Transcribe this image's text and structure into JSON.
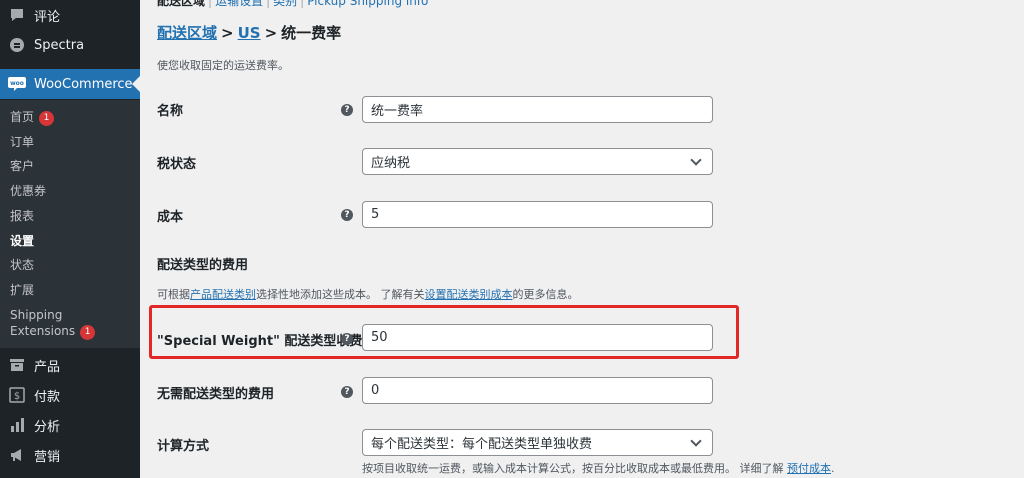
{
  "sidebar": {
    "comments": "评论",
    "spectra": "Spectra",
    "woocommerce": "WooCommerce",
    "submenu": {
      "home": "首页",
      "home_badge": "1",
      "orders": "订单",
      "customers": "客户",
      "coupons": "优惠券",
      "reports": "报表",
      "settings": "设置",
      "status": "状态",
      "extensions": "扩展",
      "shipping_ext_line1": "Shipping",
      "shipping_ext_line2": "Extensions",
      "shipping_ext_badge": "1"
    },
    "products": "产品",
    "payments": "付款",
    "analytics": "分析",
    "marketing": "营销"
  },
  "top_links": {
    "zones": "配送区域",
    "options": "运输设置",
    "classes": "类别",
    "local_pickup": "Pickup Shipping info"
  },
  "breadcrumb": {
    "zones_link": "配送区域",
    "sep1": ">",
    "zone_link": "US",
    "sep2": ">",
    "current": "统一费率"
  },
  "description": "使您收取固定的运送费率。",
  "form": {
    "name_label": "名称",
    "name_value": "统一费率",
    "tax_label": "税状态",
    "tax_value": "应纳税",
    "cost_label": "成本",
    "cost_value": "5",
    "section_title": "配送类型的费用",
    "section_desc_prefix": "可根据",
    "section_desc_link1": "产品配送类别",
    "section_desc_mid": "选择性地添加这些成本。 了解有关",
    "section_desc_link2": "设置配送类别成本",
    "section_desc_suffix": "的更多信息。",
    "special_label": "\"Special Weight\" 配送类型收费",
    "special_value": "50",
    "no_class_label": "无需配送类型的费用",
    "no_class_value": "0",
    "calc_label": "计算方式",
    "calc_value": "每个配送类型：每个配送类型单独收费",
    "hint_text": "按项目收取统一运费，或输入成本计算公式，按百分比收取成本或最低费用。 详细了解",
    "hint_link": "预付成本",
    "hint_end": "."
  },
  "help_glyph": "?",
  "colors": {
    "sidebar_bg": "#1d2327",
    "active_bg": "#2271b1",
    "link": "#2271b1",
    "highlight": "#e32727",
    "badge": "#d63638"
  }
}
